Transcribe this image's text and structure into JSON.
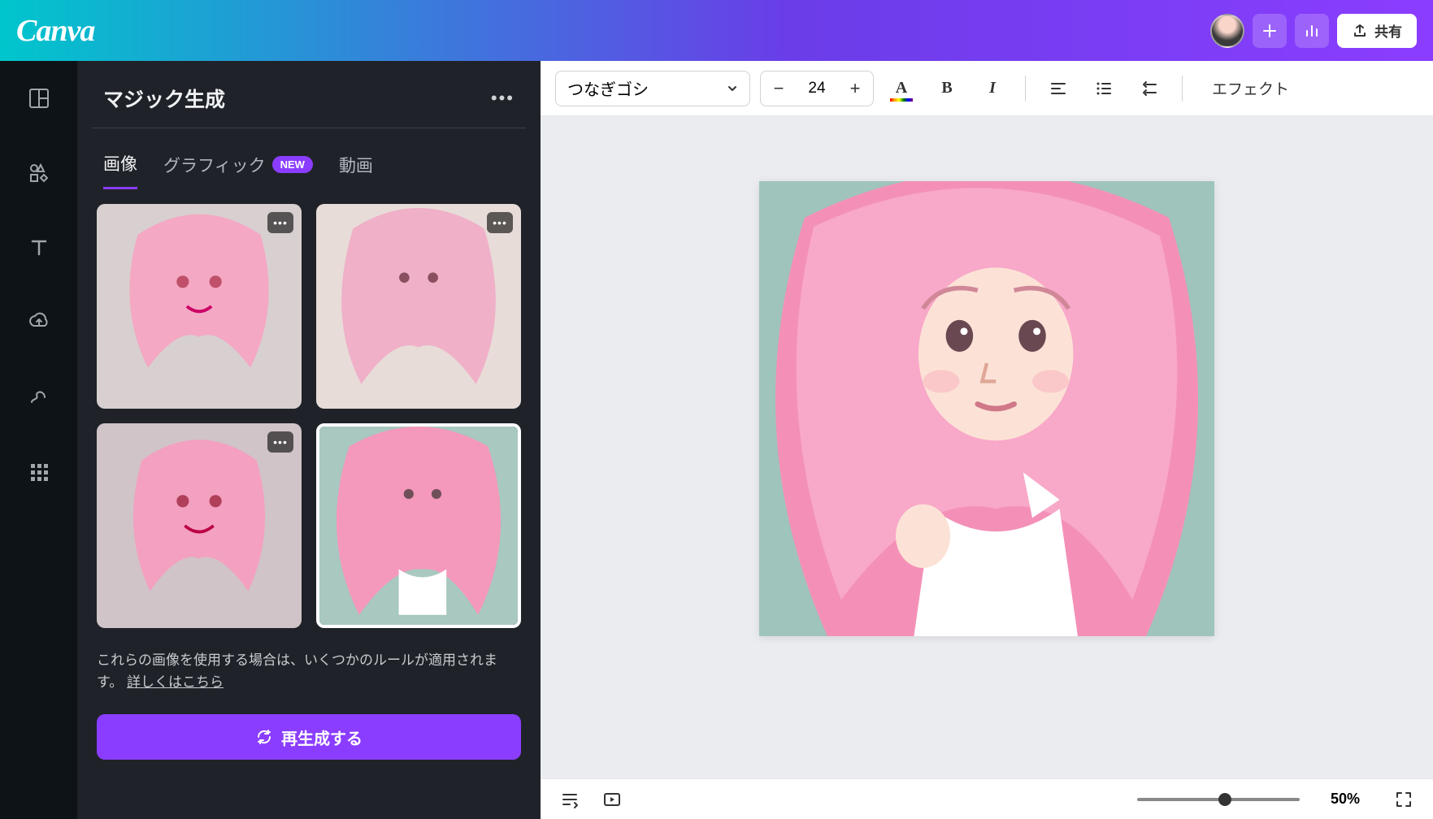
{
  "topbar": {
    "logo": "Canva",
    "share_label": "共有"
  },
  "sidebar": {
    "title": "マジック生成",
    "tabs": [
      {
        "label": "画像",
        "active": true
      },
      {
        "label": "グラフィック",
        "badge": "NEW"
      },
      {
        "label": "動画"
      }
    ],
    "note_text": "これらの画像を使用する場合は、いくつかのルールが適用されます。",
    "note_link": "詳しくはこちら",
    "regenerate_label": "再生成する"
  },
  "toolbar": {
    "font_name": "つなぎゴシ",
    "font_size": "24",
    "effect_label": "エフェクト"
  },
  "bottombar": {
    "zoom_label": "50%"
  }
}
